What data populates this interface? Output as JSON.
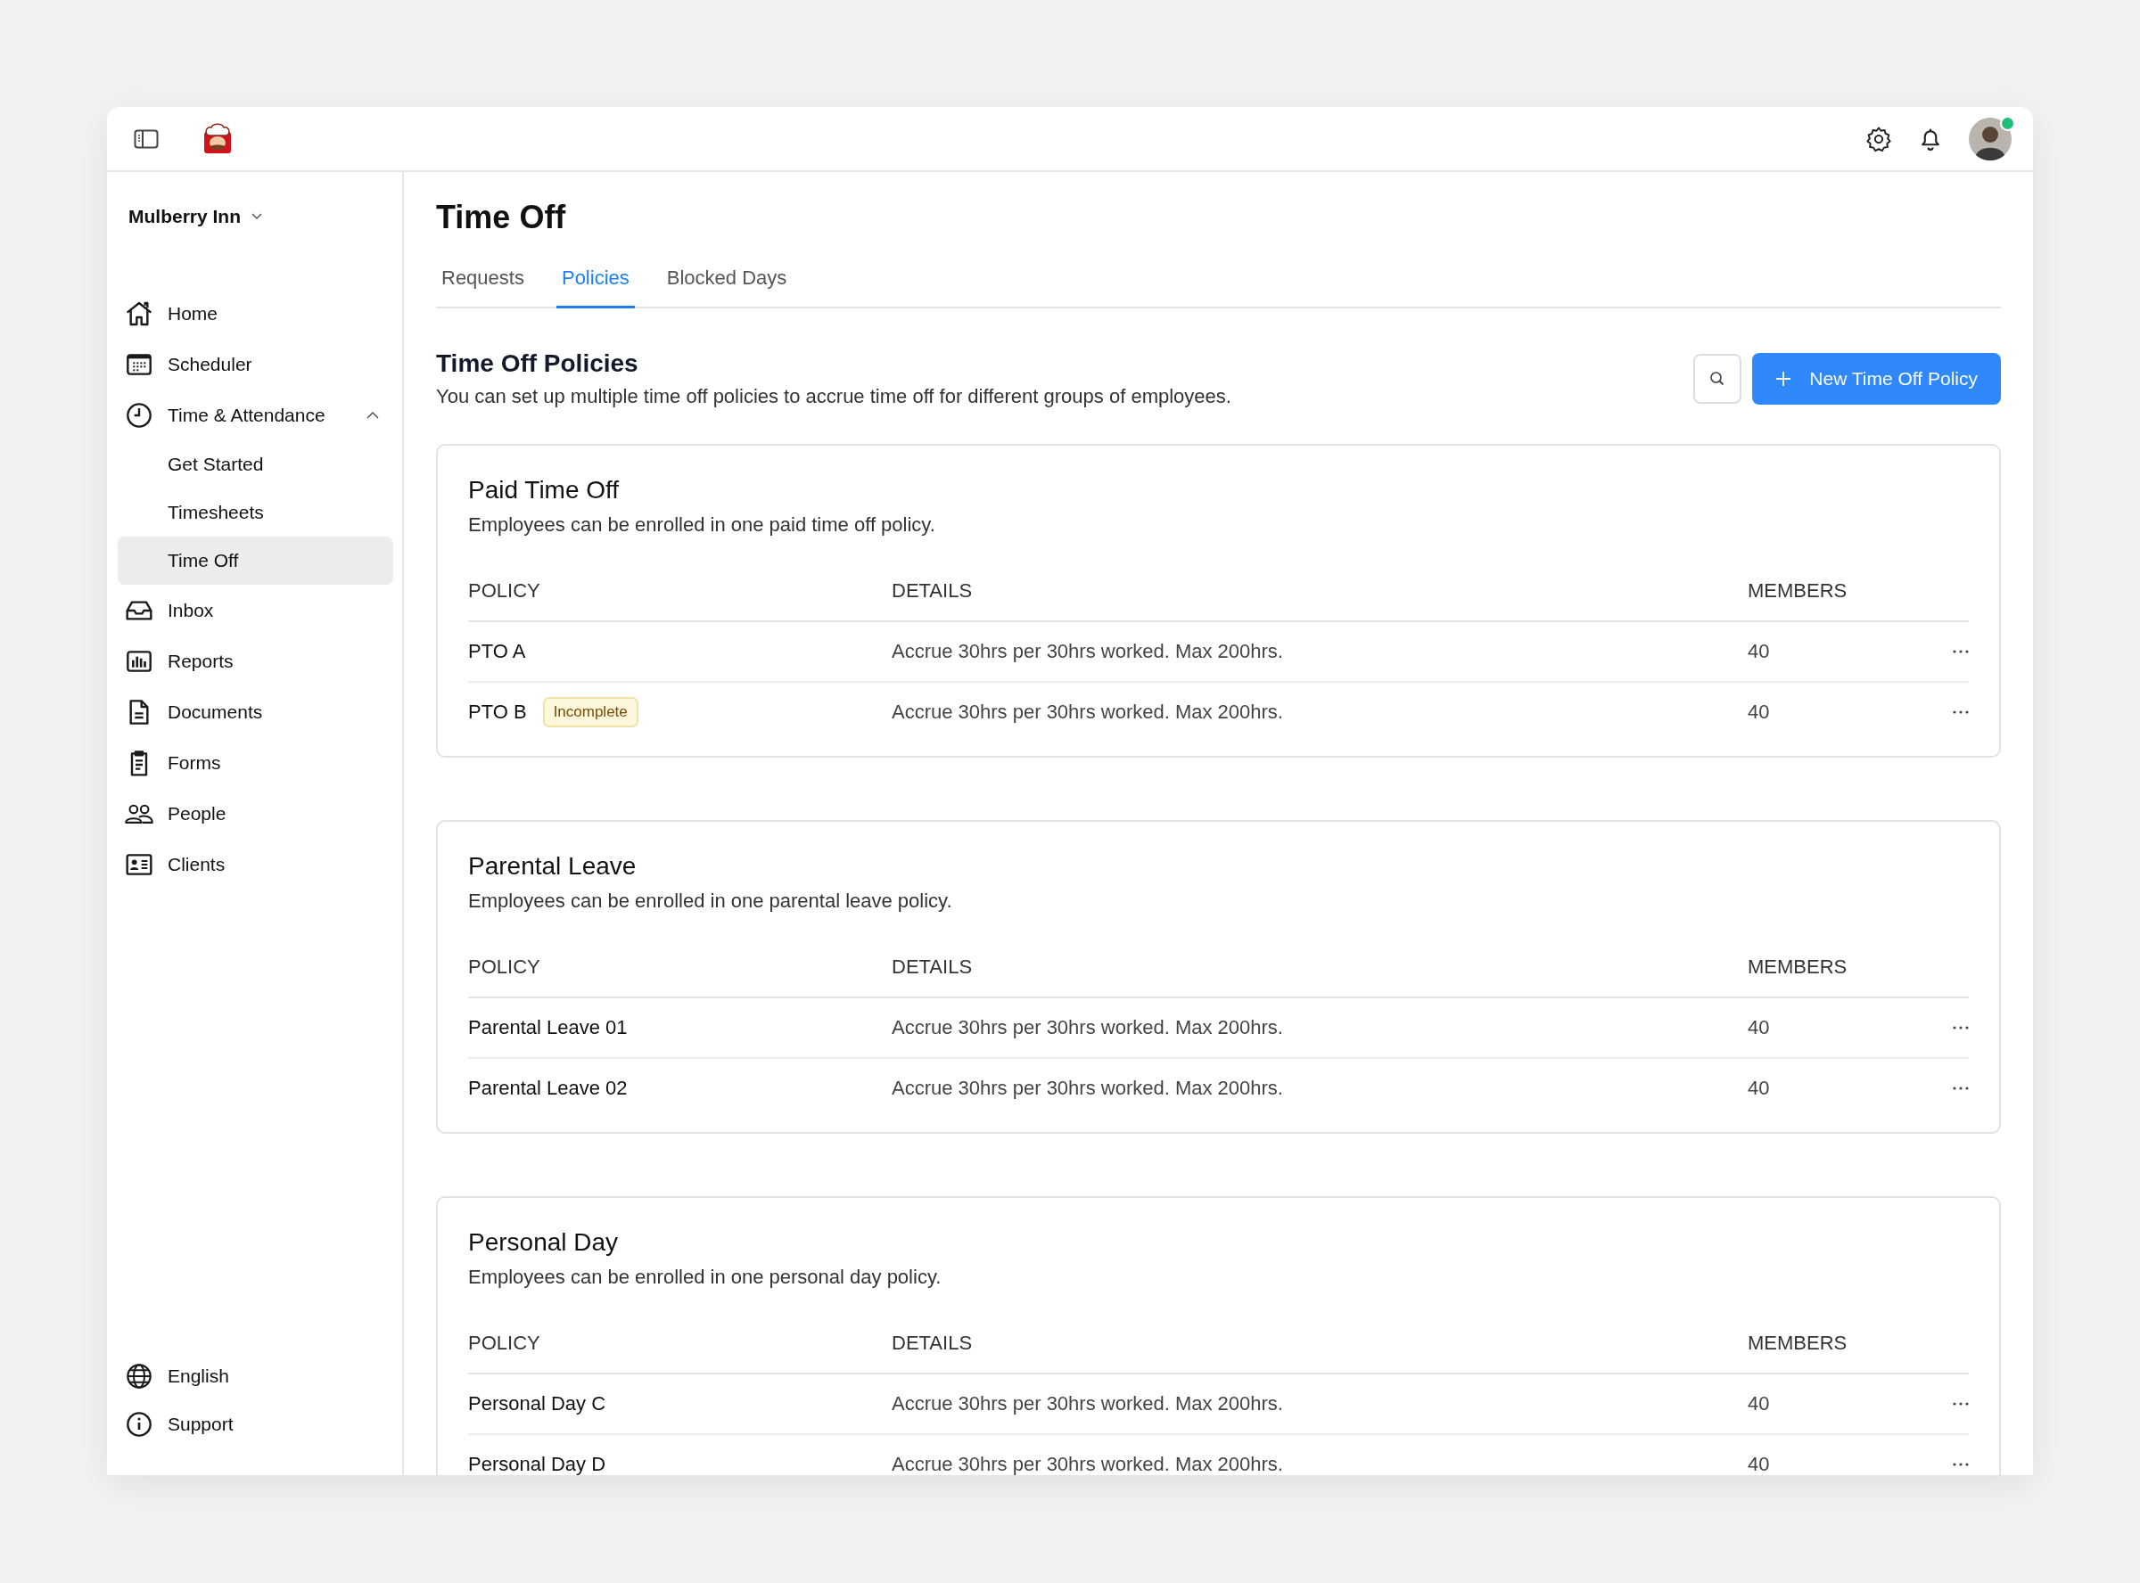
{
  "user": {
    "online": true
  },
  "sidebar": {
    "org": "Mulberry Inn",
    "items": [
      {
        "label": "Home",
        "kind": "home",
        "selected": false
      },
      {
        "label": "Scheduler",
        "kind": "calendar",
        "selected": false
      },
      {
        "label": "Time & Attendance",
        "kind": "clock",
        "selected": false,
        "expanded": true,
        "children": [
          {
            "label": "Get Started",
            "selected": false
          },
          {
            "label": "Timesheets",
            "selected": false
          },
          {
            "label": "Time Off",
            "selected": true
          }
        ]
      },
      {
        "label": "Inbox",
        "kind": "inbox",
        "selected": false
      },
      {
        "label": "Reports",
        "kind": "chart",
        "selected": false
      },
      {
        "label": "Documents",
        "kind": "document",
        "selected": false
      },
      {
        "label": "Forms",
        "kind": "clipboard",
        "selected": false
      },
      {
        "label": "People",
        "kind": "people",
        "selected": false
      },
      {
        "label": "Clients",
        "kind": "card",
        "selected": false
      }
    ],
    "footer": [
      {
        "label": "English",
        "kind": "globe"
      },
      {
        "label": "Support",
        "kind": "info"
      }
    ]
  },
  "page": {
    "title": "Time Off",
    "tabs": [
      {
        "label": "Requests",
        "selected": false
      },
      {
        "label": "Policies",
        "selected": true
      },
      {
        "label": "Blocked Days",
        "selected": false
      }
    ]
  },
  "section": {
    "title": "Time Off Policies",
    "description": "You can set up multiple time off policies to accrue time off for different groups of employees.",
    "button": "New Time Off Policy"
  },
  "groups": [
    {
      "title": "Paid Time Off",
      "description": "Employees can be enrolled in one paid time off policy.",
      "columns": [
        "POLICY",
        "DETAILS",
        "MEMBERS"
      ],
      "rows": [
        {
          "policy": "PTO A",
          "details": "Accrue 30hrs per 30hrs worked. Max 200hrs.",
          "members": "40"
        },
        {
          "policy": "PTO B",
          "badge": "Incomplete",
          "details": "Accrue 30hrs per 30hrs worked. Max 200hrs.",
          "members": "40"
        }
      ]
    },
    {
      "title": "Parental Leave",
      "description": "Employees can be enrolled in one parental leave policy.",
      "columns": [
        "POLICY",
        "DETAILS",
        "MEMBERS"
      ],
      "rows": [
        {
          "policy": "Parental Leave 01",
          "details": "Accrue 30hrs per 30hrs worked. Max 200hrs.",
          "members": "40"
        },
        {
          "policy": "Parental Leave 02",
          "details": "Accrue 30hrs per 30hrs worked. Max 200hrs.",
          "members": "40"
        }
      ]
    },
    {
      "title": "Personal Day",
      "description": "Employees can be enrolled in one personal day policy.",
      "columns": [
        "POLICY",
        "DETAILS",
        "MEMBERS"
      ],
      "rows": [
        {
          "policy": "Personal Day C",
          "details": "Accrue 30hrs per 30hrs worked. Max 200hrs.",
          "members": "40"
        },
        {
          "policy": "Personal Day D",
          "details": "Accrue 30hrs per 30hrs worked. Max 200hrs.",
          "members": "40"
        }
      ]
    }
  ]
}
